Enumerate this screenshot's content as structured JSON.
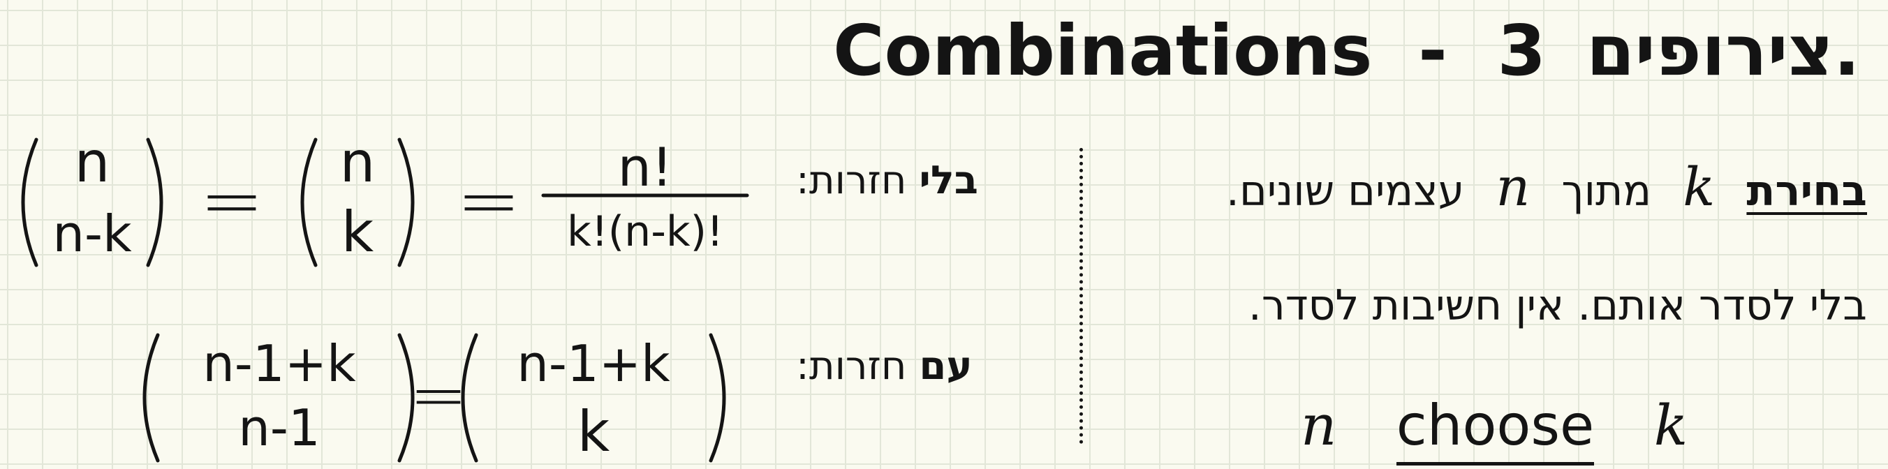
{
  "title": {
    "number": "3.",
    "hebrew": "צירופים",
    "dash": "-",
    "english": "Combinations"
  },
  "right_column": {
    "line1_word1": "בחירת",
    "line1_k": "k",
    "line1_mid": "מתוך",
    "line1_n": "n",
    "line1_end": "עצמים שונים.",
    "line2": "בלי לסדר אותם. אין חשיבות לסדר.",
    "choose_n": "n",
    "choose_word": "choose",
    "choose_k": "k"
  },
  "labels": {
    "without_repetition": "בלי",
    "without_repetition_rest": "חזרות:",
    "with_repetition": "עם",
    "with_repetition_rest": "חזרות:"
  },
  "formula1": {
    "binom1_top": "n",
    "binom1_bottom": "n-k",
    "eq1": "=",
    "binom2_top": "n",
    "binom2_bottom": "k",
    "eq2": "=",
    "frac_num": "n!",
    "frac_den": "k!(n-k)!"
  },
  "formula2": {
    "binom1_top": "n-1+k",
    "binom1_bottom": "n-1",
    "eq": "=",
    "binom2_top": "n-1+k",
    "binom2_bottom": "k"
  }
}
